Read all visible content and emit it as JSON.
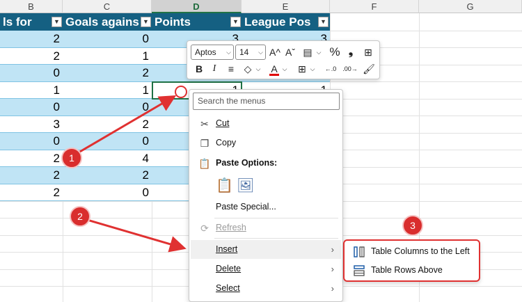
{
  "columns": [
    {
      "letter": "B"
    },
    {
      "letter": "C"
    },
    {
      "letter": "D"
    },
    {
      "letter": "E"
    },
    {
      "letter": "F"
    },
    {
      "letter": "G"
    }
  ],
  "table_header": {
    "col_b": "ls for",
    "col_c": "Goals agains",
    "col_d": "Points",
    "col_e": "League Pos"
  },
  "rows": [
    {
      "b": "2",
      "c": "0",
      "d": "3",
      "e": "3"
    },
    {
      "b": "2",
      "c": "1",
      "d": "",
      "e": ""
    },
    {
      "b": "0",
      "c": "2",
      "d": "",
      "e": ""
    },
    {
      "b": "1",
      "c": "1",
      "d": "1",
      "e": "1"
    },
    {
      "b": "0",
      "c": "0",
      "d": "",
      "e": ""
    },
    {
      "b": "3",
      "c": "2",
      "d": "",
      "e": ""
    },
    {
      "b": "0",
      "c": "0",
      "d": "",
      "e": ""
    },
    {
      "b": "2",
      "c": "4",
      "d": "",
      "e": ""
    },
    {
      "b": "2",
      "c": "2",
      "d": "",
      "e": ""
    },
    {
      "b": "2",
      "c": "0",
      "d": "",
      "e": ""
    }
  ],
  "mini_toolbar": {
    "font_name": "Aptos",
    "font_size": "14",
    "grow_font": "A^",
    "shrink_font": "Aˇ",
    "percent": "%",
    "comma": "❟",
    "bold": "B",
    "italic": "I",
    "font_color_letter": "A",
    "increase_decimal": "←.0",
    "decrease_decimal": ".00→"
  },
  "context_menu": {
    "search_placeholder": "Search the menus",
    "cut": "Cut",
    "copy": "Copy",
    "paste_options": "Paste Options:",
    "paste_special": "Paste Special...",
    "refresh": "Refresh",
    "insert": "Insert",
    "delete": "Delete",
    "select": "Select"
  },
  "submenu": {
    "columns_left": "Table Columns to the Left",
    "rows_above": "Table Rows Above"
  },
  "annotations": {
    "badge1": "1",
    "badge2": "2",
    "badge3": "3",
    "color": "#d92d2d"
  },
  "colors": {
    "table_header": "#156082",
    "band": "#c0e4f5",
    "accent": "#217346",
    "annotation": "#e03131"
  }
}
